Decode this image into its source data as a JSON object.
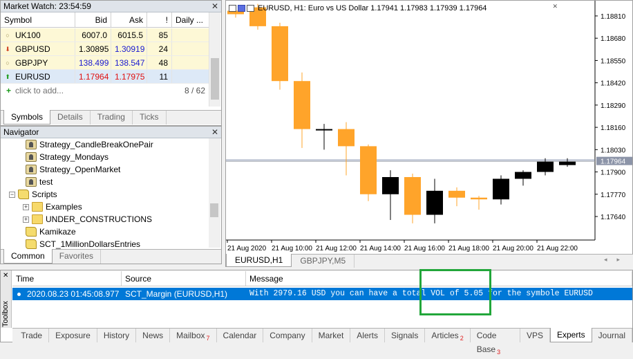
{
  "market_watch": {
    "title": "Market Watch: 23:54:59",
    "columns": [
      "Symbol",
      "Bid",
      "Ask",
      "!",
      "Daily ..."
    ],
    "rows": [
      {
        "symbol": "UK100",
        "bid": "6007.0",
        "ask": "6015.5",
        "spread": "85",
        "icon": "circle-icon",
        "bid_color": "#000000",
        "ask_color": "#000000"
      },
      {
        "symbol": "GBPUSD",
        "bid": "1.30895",
        "ask": "1.30919",
        "spread": "24",
        "icon": "arrow-down-icon",
        "bid_color": "#000000",
        "ask_color": "#1a1ad0"
      },
      {
        "symbol": "GBPJPY",
        "bid": "138.499",
        "ask": "138.547",
        "spread": "48",
        "icon": "circle-icon",
        "bid_color": "#1a1ad0",
        "ask_color": "#1a1ad0"
      },
      {
        "symbol": "EURUSD",
        "bid": "1.17964",
        "ask": "1.17975",
        "spread": "11",
        "icon": "arrow-up-icon",
        "bid_color": "#e01010",
        "ask_color": "#e01010"
      }
    ],
    "add_label": "click to add...",
    "count": "8 / 62",
    "tabs": [
      "Symbols",
      "Details",
      "Trading",
      "Ticks"
    ]
  },
  "navigator": {
    "title": "Navigator",
    "items": [
      {
        "label": "Strategy_CandleBreakOnePair",
        "type": "strategy"
      },
      {
        "label": "Strategy_Mondays",
        "type": "strategy"
      },
      {
        "label": "Strategy_OpenMarket",
        "type": "strategy"
      },
      {
        "label": "test",
        "type": "strategy"
      },
      {
        "label": "Scripts",
        "type": "scripts-root"
      },
      {
        "label": "Examples",
        "type": "folder"
      },
      {
        "label": "UNDER_CONSTRUCTIONS",
        "type": "folder"
      },
      {
        "label": "Kamikaze",
        "type": "script"
      },
      {
        "label": "SCT_1MillionDollarsEntries",
        "type": "script"
      }
    ],
    "tabs": [
      "Common",
      "Favorites"
    ]
  },
  "chart": {
    "title": "EURUSD, H1:  Euro vs US Dollar  1.17941 1.17983 1.17939 1.17964",
    "tabs": [
      "EURUSD,H1",
      "GBPJPY,M5"
    ],
    "bull_color": "#000000",
    "bear_color": "#ffa42a",
    "current_price": "1.17964"
  },
  "chart_data": {
    "type": "candlestick",
    "symbol": "EURUSD",
    "timeframe": "H1",
    "y_ticks": [
      "1.18810",
      "1.18680",
      "1.18550",
      "1.18420",
      "1.18290",
      "1.18160",
      "1.18030",
      "1.17900",
      "1.17770",
      "1.17640"
    ],
    "x_ticks": [
      "21 Aug 2020",
      "21 Aug 10:00",
      "21 Aug 12:00",
      "21 Aug 14:00",
      "21 Aug 16:00",
      "21 Aug 18:00",
      "21 Aug 20:00",
      "21 Aug 22:00"
    ],
    "ylim": [
      1.1757,
      1.1888
    ],
    "current_price": 1.17964,
    "candles": [
      {
        "o": 1.1884,
        "h": 1.1884,
        "l": 1.188,
        "c": 1.1882
      },
      {
        "o": 1.1886,
        "h": 1.1888,
        "l": 1.1873,
        "c": 1.1875
      },
      {
        "o": 1.1875,
        "h": 1.1877,
        "l": 1.1838,
        "c": 1.1843
      },
      {
        "o": 1.1843,
        "h": 1.1848,
        "l": 1.1804,
        "c": 1.1815
      },
      {
        "o": 1.1815,
        "h": 1.1818,
        "l": 1.1803,
        "c": 1.1815
      },
      {
        "o": 1.1815,
        "h": 1.1819,
        "l": 1.1788,
        "c": 1.1805
      },
      {
        "o": 1.1805,
        "h": 1.1806,
        "l": 1.1773,
        "c": 1.1777
      },
      {
        "o": 1.1777,
        "h": 1.1791,
        "l": 1.1762,
        "c": 1.1787
      },
      {
        "o": 1.1787,
        "h": 1.1789,
        "l": 1.176,
        "c": 1.1765
      },
      {
        "o": 1.1765,
        "h": 1.1786,
        "l": 1.176,
        "c": 1.1779
      },
      {
        "o": 1.1779,
        "h": 1.1781,
        "l": 1.177,
        "c": 1.1775
      },
      {
        "o": 1.1775,
        "h": 1.1776,
        "l": 1.1768,
        "c": 1.1774
      },
      {
        "o": 1.1774,
        "h": 1.1788,
        "l": 1.1771,
        "c": 1.1786
      },
      {
        "o": 1.1786,
        "h": 1.1791,
        "l": 1.1782,
        "c": 1.179
      },
      {
        "o": 1.179,
        "h": 1.1798,
        "l": 1.1788,
        "c": 1.1796
      },
      {
        "o": 1.1794,
        "h": 1.1798,
        "l": 1.1793,
        "c": 1.1796
      }
    ]
  },
  "toolbox": {
    "label": "Toolbox",
    "columns": [
      "Time",
      "Source",
      "Message"
    ],
    "row": {
      "time": "2020.08.23 01:45:08.977",
      "source": "SCT_Margin (EURUSD,H1)",
      "message": "With 2979.16 USD you can have a total VOL of 5.05 for the symbole EURUSD"
    },
    "tabs": [
      {
        "label": "Trade",
        "badge": ""
      },
      {
        "label": "Exposure",
        "badge": ""
      },
      {
        "label": "History",
        "badge": ""
      },
      {
        "label": "News",
        "badge": ""
      },
      {
        "label": "Mailbox",
        "badge": "7"
      },
      {
        "label": "Calendar",
        "badge": ""
      },
      {
        "label": "Company",
        "badge": ""
      },
      {
        "label": "Market",
        "badge": ""
      },
      {
        "label": "Alerts",
        "badge": ""
      },
      {
        "label": "Signals",
        "badge": ""
      },
      {
        "label": "Articles",
        "badge": "2"
      },
      {
        "label": "Code Base",
        "badge": "3"
      },
      {
        "label": "VPS",
        "badge": ""
      },
      {
        "label": "Experts",
        "badge": ""
      },
      {
        "label": "Journal",
        "badge": ""
      }
    ],
    "active_tab": "Experts",
    "highlight_color": "#22a63a"
  }
}
